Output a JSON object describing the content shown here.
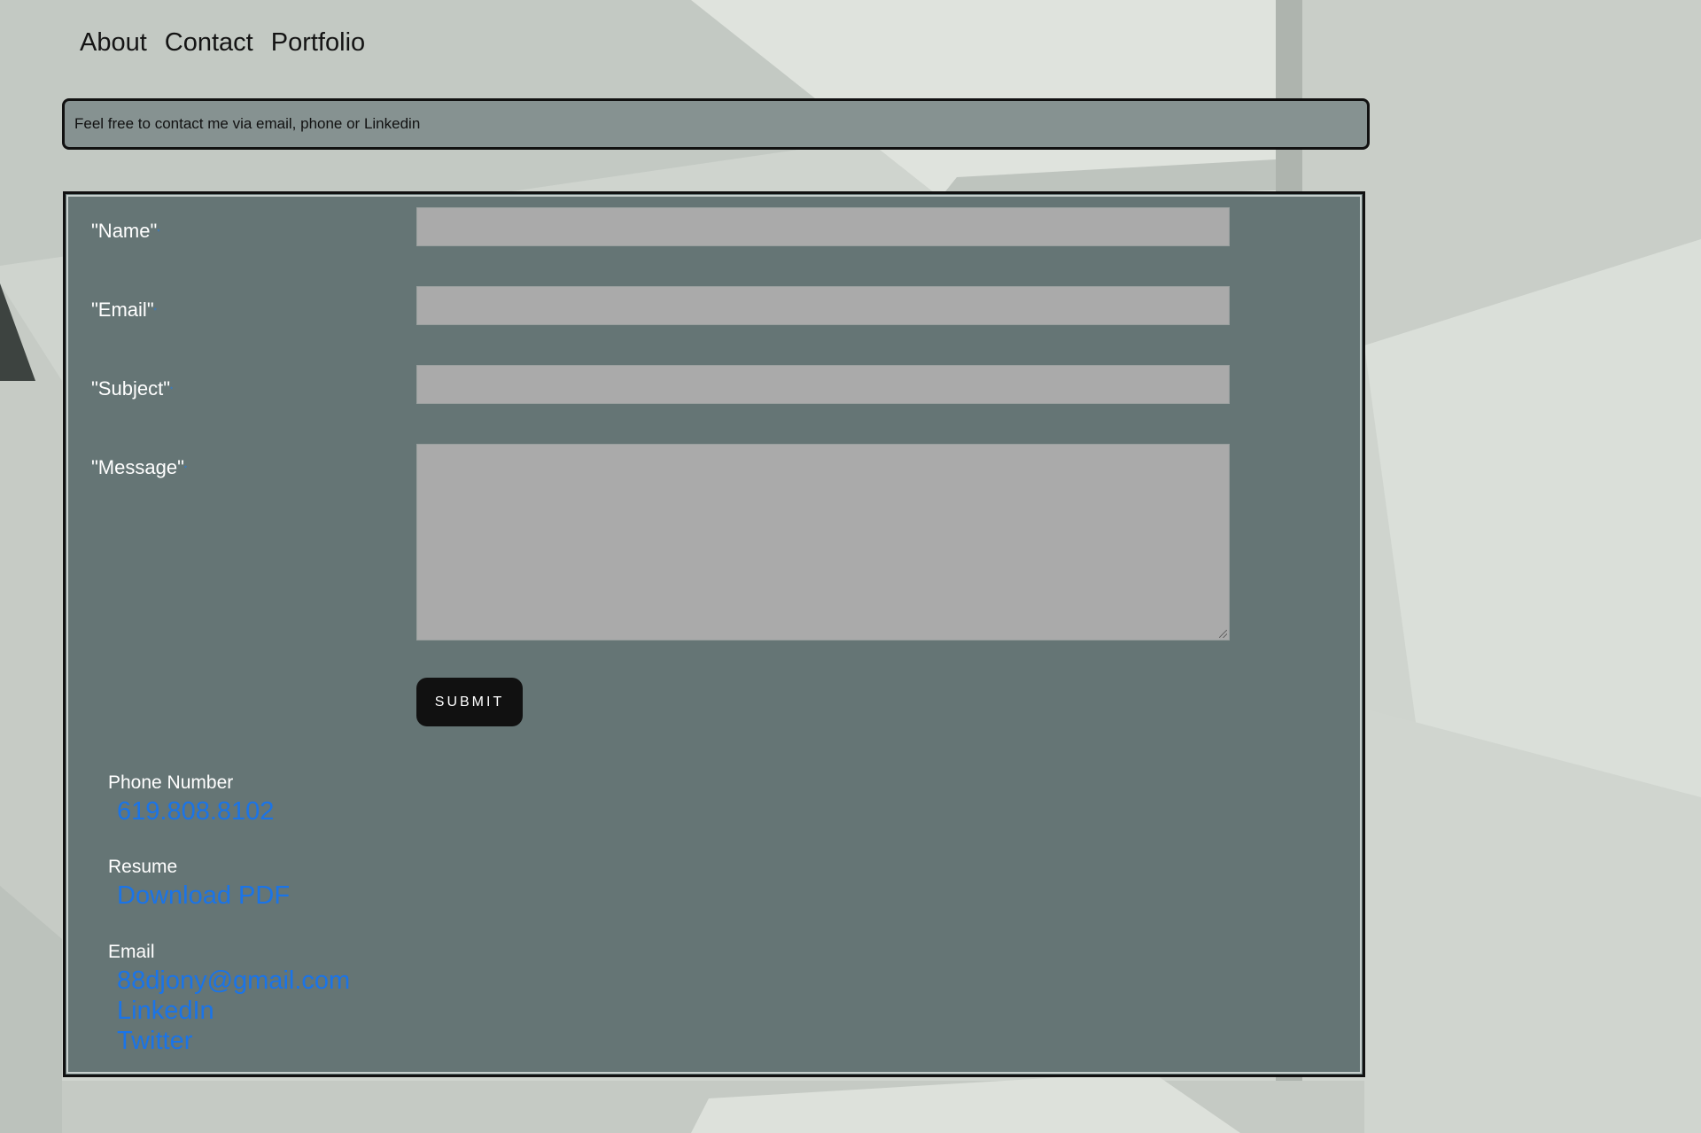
{
  "nav": {
    "items": [
      {
        "label": "About"
      },
      {
        "label": "Contact"
      },
      {
        "label": "Portfolio"
      }
    ]
  },
  "intro": {
    "text": "Feel free to contact me via email, phone or Linkedin"
  },
  "form": {
    "name_label": "\"Name\"",
    "email_label": "\"Email\"",
    "subject_label": "\"Subject\"",
    "message_label": "\"Message\"",
    "required_marker": "*",
    "name_value": "",
    "email_value": "",
    "subject_value": "",
    "message_value": "",
    "submit_label": "SUBMIT"
  },
  "contact": {
    "phone_heading": "Phone Number",
    "phone": "619.808.8102",
    "resume_heading": "Resume",
    "resume_link": "Download PDF",
    "email_heading": "Email",
    "email": "88djony@gmail.com",
    "linkedin": "LinkedIn",
    "twitter": "Twitter"
  },
  "colors": {
    "panel": "#657575",
    "intro_bg": "#869291",
    "field_bg": "#aaaaaa",
    "link": "#1a74e8",
    "button_bg": "#111111"
  }
}
